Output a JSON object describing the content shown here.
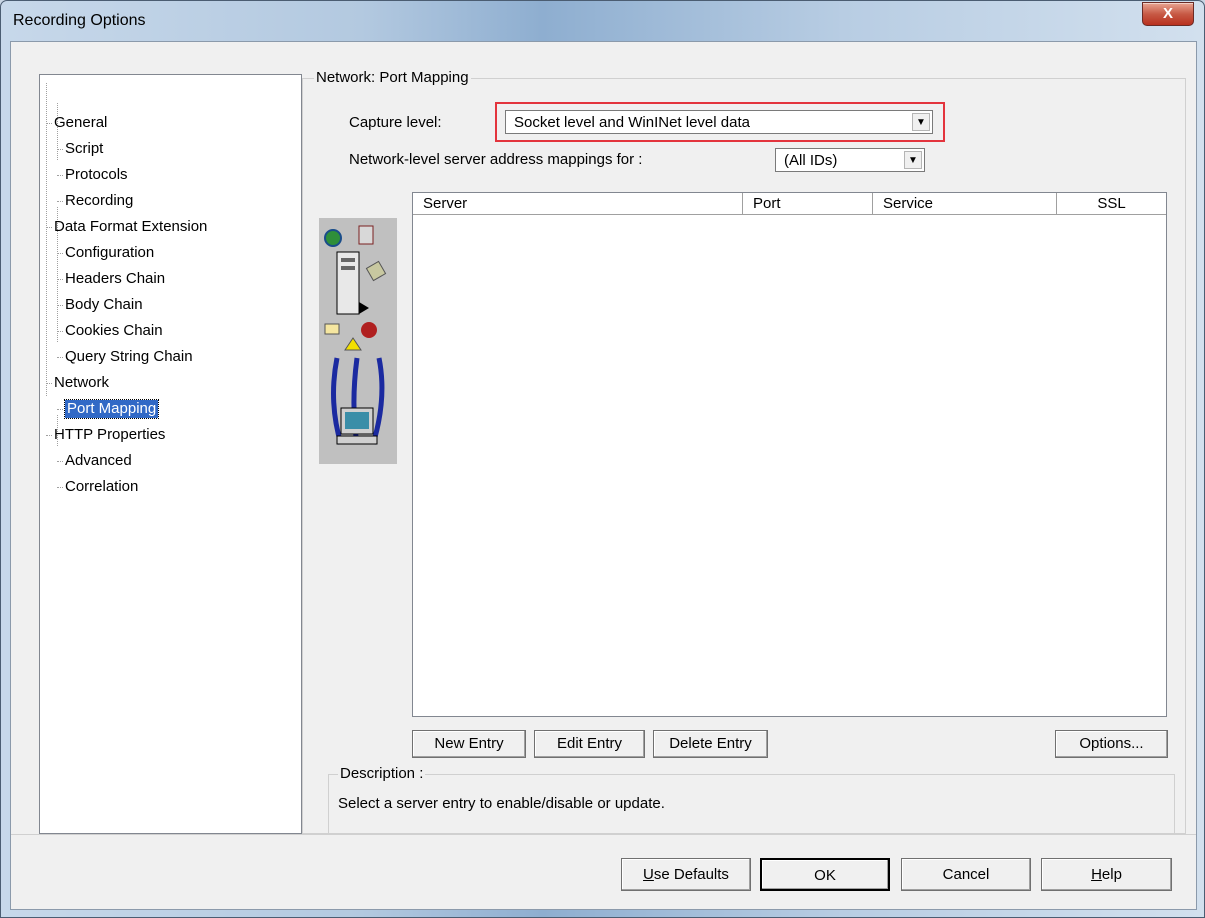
{
  "window": {
    "title": "Recording Options",
    "close_label": "X"
  },
  "tree": [
    {
      "label": "General",
      "level": 0
    },
    {
      "label": "Script",
      "level": 1
    },
    {
      "label": "Protocols",
      "level": 1
    },
    {
      "label": "Recording",
      "level": 1
    },
    {
      "label": "Data Format Extension",
      "level": 0
    },
    {
      "label": "Configuration",
      "level": 1
    },
    {
      "label": "Headers Chain",
      "level": 1
    },
    {
      "label": "Body Chain",
      "level": 1
    },
    {
      "label": "Cookies Chain",
      "level": 1
    },
    {
      "label": "Query String Chain",
      "level": 1
    },
    {
      "label": "Network",
      "level": 0
    },
    {
      "label": "Port Mapping",
      "level": 1,
      "selected": true
    },
    {
      "label": "HTTP Properties",
      "level": 0
    },
    {
      "label": "Advanced",
      "level": 1
    },
    {
      "label": "Correlation",
      "level": 1
    }
  ],
  "panel": {
    "group_title": "Network: Port Mapping",
    "capture_level_label": "Capture level:",
    "capture_level_value": "Socket level and WinINet level data",
    "mappings_label": "Network-level server address mappings for :",
    "mappings_value": "(All IDs)",
    "columns": [
      "Server",
      "Port",
      "Service",
      "SSL"
    ],
    "buttons": {
      "new_entry": "New Entry",
      "edit_entry": "Edit Entry",
      "delete_entry": "Delete Entry",
      "options": "Options..."
    },
    "description_title": "Description :",
    "description_text": "Select a server entry to enable/disable or update."
  },
  "footer": {
    "use_defaults_mnemonic": "U",
    "use_defaults_rest": "se Defaults",
    "ok": "OK",
    "cancel": "Cancel",
    "help_mnemonic": "H",
    "help_rest": "elp"
  }
}
